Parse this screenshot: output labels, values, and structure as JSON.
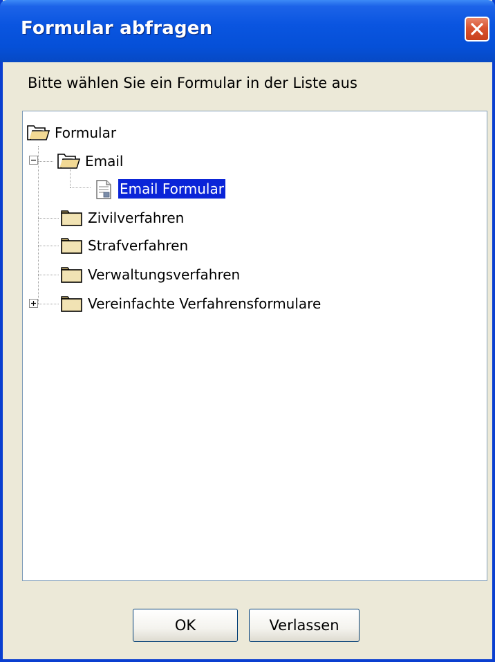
{
  "dialog": {
    "title": "Formular abfragen",
    "prompt": "Bitte wählen Sie ein Formular in der Liste aus"
  },
  "tree": {
    "root": {
      "label": "Formular",
      "icon": "open-folder-icon"
    },
    "items": [
      {
        "label": "Email",
        "icon": "open-folder-icon",
        "expanded": true
      },
      {
        "label": "Email Formular",
        "icon": "form-document-icon",
        "selected": true
      },
      {
        "label": "Zivilverfahren",
        "icon": "folder-icon"
      },
      {
        "label": "Strafverfahren",
        "icon": "folder-icon"
      },
      {
        "label": "Verwaltungsverfahren",
        "icon": "folder-icon"
      },
      {
        "label": "Vereinfachte Verfahrensformulare",
        "icon": "folder-icon",
        "expanded": false
      }
    ]
  },
  "buttons": {
    "ok": "OK",
    "exit": "Verlassen"
  },
  "colors": {
    "titlebar": "#0550d8",
    "selection": "#0a24d8",
    "dialog_bg": "#ece9d8",
    "close_button": "#d9532f"
  }
}
